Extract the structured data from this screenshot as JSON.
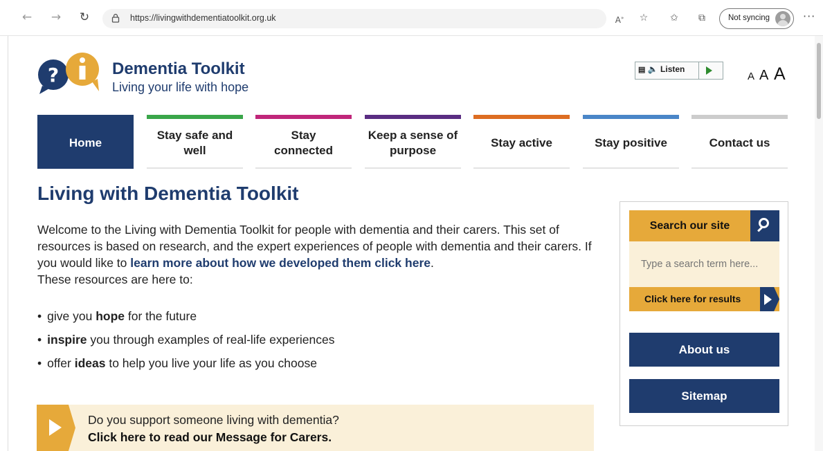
{
  "browser": {
    "url": "https://livingwithdementiatoolkit.org.uk",
    "sync_label": "Not syncing",
    "more": "···",
    "icons": [
      "back-icon",
      "forward-icon",
      "refresh-icon",
      "lock-icon",
      "read-aloud-icon",
      "favorite-add-icon",
      "favorites-icon",
      "collections-icon",
      "profile-icon",
      "more-icon"
    ]
  },
  "header": {
    "title": "Dementia Toolkit",
    "tagline": "Living your life with hope",
    "listen_label": "Listen",
    "font_sizes": [
      "A",
      "A",
      "A"
    ]
  },
  "nav": [
    {
      "label": "Home",
      "color": "#1f3c6e"
    },
    {
      "label": "Stay safe and well",
      "color": "#3aa64a"
    },
    {
      "label": "Stay connected",
      "color": "#c0267a"
    },
    {
      "label": "Keep a sense of purpose",
      "color": "#5a2d82"
    },
    {
      "label": "Stay active",
      "color": "#dd6d22"
    },
    {
      "label": "Stay positive",
      "color": "#4a86c8"
    },
    {
      "label": "Contact us",
      "color": "#cccccc"
    }
  ],
  "main": {
    "heading": "Living with Dementia Toolkit",
    "intro_1": "Welcome to the Living with Dementia Toolkit for people with dementia and their carers. This set of resources is based on research, and the expert experiences of people with dementia and their carers. If you would like to ",
    "intro_link": "learn more about how we developed them click here",
    "intro_2": ".",
    "intro_3": "These resources are here to:",
    "bullets": [
      {
        "pre": "give you ",
        "bold": "hope",
        "post": " for the future"
      },
      {
        "pre": "",
        "bold": "inspire",
        "post": " you through examples of real-life experiences"
      },
      {
        "pre": "offer ",
        "bold": "ideas",
        "post": " to help you live your life as you choose"
      }
    ],
    "carer_question": "Do you support someone living with dementia?",
    "carer_link": "Click here to read our Message for Carers."
  },
  "sidebar": {
    "search_title": "Search our site",
    "search_placeholder": "Type a search term here...",
    "results_label": "Click here for results",
    "about_label": "About us",
    "sitemap_label": "Sitemap"
  },
  "colors": {
    "brand_navy": "#1f3c6e",
    "brand_gold": "#e6a93a",
    "cream": "#faf0d9"
  }
}
